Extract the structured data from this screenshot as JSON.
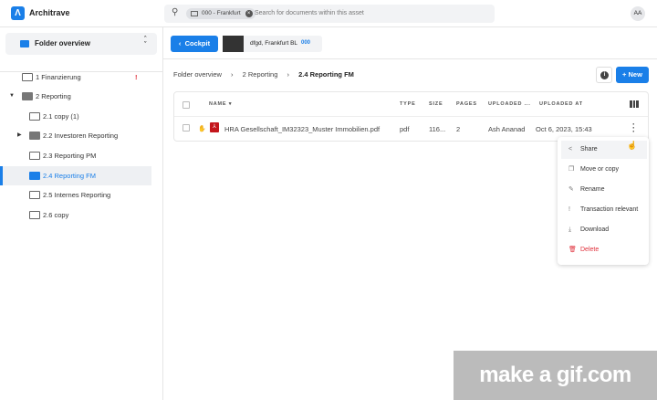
{
  "app": {
    "name": "Architrave",
    "avatar": "AA"
  },
  "search": {
    "chip": "000 - Frankfurt",
    "placeholder": "Search for documents within this asset"
  },
  "sidebar": {
    "selector": "Folder overview",
    "items": [
      {
        "label": "1 Finanzierung",
        "flag": "!"
      },
      {
        "label": "2 Reporting"
      },
      {
        "label": "2.1 copy (1)"
      },
      {
        "label": "2.2 Investoren Reporting"
      },
      {
        "label": "2.3 Reporting PM"
      },
      {
        "label": "2.4 Reporting FM"
      },
      {
        "label": "2.5 Internes Reporting"
      },
      {
        "label": "2.6 copy"
      }
    ]
  },
  "header": {
    "back": "Cockpit",
    "asset": "dfgd,  Frankfurt BL",
    "asset_badge": "000"
  },
  "breadcrumb": [
    "Folder overview",
    "2 Reporting",
    "2.4 Reporting FM"
  ],
  "toolbar": {
    "info": "i",
    "new": "New"
  },
  "table": {
    "columns": [
      "NAME",
      "TYPE",
      "SIZE",
      "PAGES",
      "UPLOADED ...",
      "UPLOADED AT"
    ],
    "rows": [
      {
        "name": "HRA Gesellschaft_IM32323_Muster Immobilien.pdf",
        "type": "pdf",
        "size": "116...",
        "pages": "2",
        "uploaded_by": "Ash Ananad",
        "uploaded_at": "Oct 6, 2023, 15:43"
      }
    ]
  },
  "menu": [
    "Share",
    "Move or copy",
    "Rename",
    "Transaction relevant",
    "Download",
    "Delete"
  ],
  "watermark": "make a gif.com",
  "colors": {
    "accent": "#1a7fe8",
    "danger": "#e0303b"
  }
}
